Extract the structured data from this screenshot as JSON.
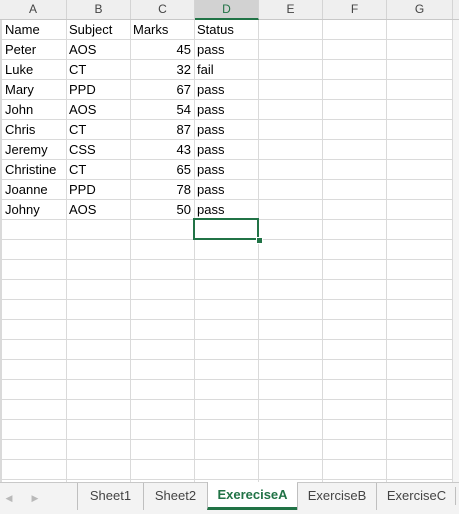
{
  "columns": [
    "A",
    "B",
    "C",
    "D",
    "E",
    "F",
    "G"
  ],
  "active_column": "D",
  "rows": [
    [
      "Name",
      "Subject",
      "Marks",
      "Status"
    ],
    [
      "Peter",
      "AOS",
      "45",
      "pass"
    ],
    [
      "Luke",
      "CT",
      "32",
      "fail"
    ],
    [
      "Mary",
      "PPD",
      "67",
      "pass"
    ],
    [
      "John",
      "AOS",
      "54",
      "pass"
    ],
    [
      "Chris",
      "CT",
      "87",
      "pass"
    ],
    [
      "Jeremy",
      "CSS",
      "43",
      "pass"
    ],
    [
      "Christine",
      "CT",
      "65",
      "pass"
    ],
    [
      "Joanne",
      "PPD",
      "78",
      "pass"
    ],
    [
      "Johny",
      "AOS",
      "50",
      "pass"
    ]
  ],
  "selected_cell": "D11",
  "sheet_tabs": [
    "Sheet1",
    "Sheet2",
    "ExereciseA",
    "ExerciseB",
    "ExerciseC"
  ],
  "active_tab": "ExereciseA",
  "colors": {
    "accent": "#217346",
    "gridline": "#dadada",
    "header_bg": "#efefef"
  }
}
